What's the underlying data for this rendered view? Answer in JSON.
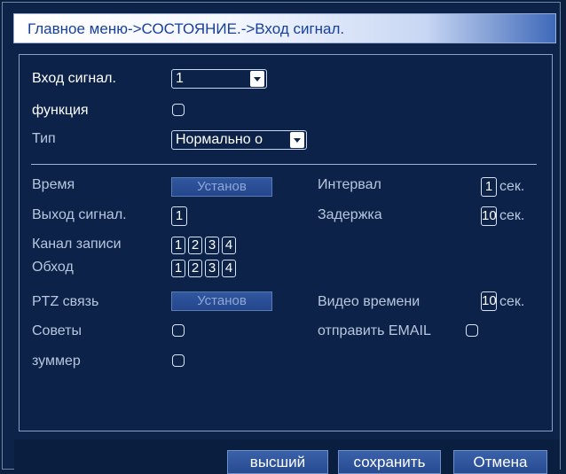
{
  "breadcrumb": "Главное меню->СОСТОЯНИЕ.->Вход сигнал.",
  "rows": {
    "alarm_input_label": "Вход сигнал.",
    "alarm_input_value": "1",
    "function_label": "функция",
    "type_label": "Тип",
    "type_value": "Нормально о",
    "time_label": "Время",
    "time_button": "Установ",
    "interval_label": "Интервал",
    "interval_value": "1",
    "interval_unit": "сек.",
    "alarm_output_label": "Выход сигнал.",
    "alarm_output_value": "1",
    "delay_label": "Задержка",
    "delay_value": "10",
    "delay_unit": "сек.",
    "record_channel_label": "Канал записи",
    "record_channels": [
      "1",
      "2",
      "3",
      "4"
    ],
    "tour_label": "Обход",
    "tour_channels": [
      "1",
      "2",
      "3",
      "4"
    ],
    "ptz_label": "PTZ связь",
    "ptz_button": "Установ",
    "video_time_label": "Видео времени",
    "video_time_value": "10",
    "video_time_unit": "сек.",
    "tips_label": "Советы",
    "send_email_label": "отправить EMAIL",
    "buzzer_label": "зуммер"
  },
  "footer": {
    "advanced": "высший",
    "save": "сохранить",
    "cancel": "Отмена"
  },
  "colors": {
    "background": "#0b1f3f",
    "title_text": "#173f9c",
    "disabled_text": "#b7c7df",
    "button_fill": "#2f559e"
  }
}
